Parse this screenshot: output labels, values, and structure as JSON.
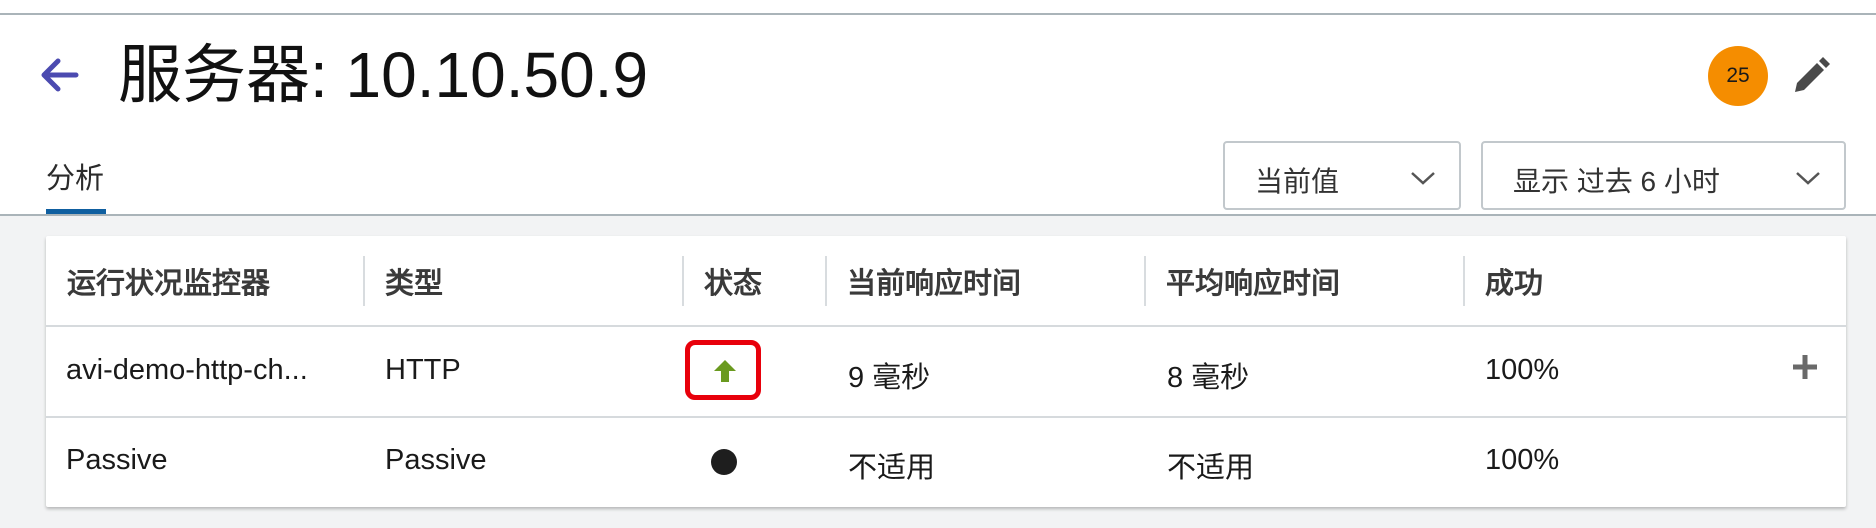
{
  "header": {
    "title": "服务器: 10.10.50.9",
    "alert_count": "25",
    "colors": {
      "badge": "#f58d00",
      "accent": "#4b4ab0",
      "tab_underline": "#0f5fa0",
      "status_up": "#6a9a1f",
      "highlight": "#e8000b"
    }
  },
  "tabs": [
    {
      "label": "分析",
      "active": true
    }
  ],
  "controls": {
    "metric_select": {
      "label": "当前值"
    },
    "time_range_select": {
      "label": "显示 过去 6 小时"
    }
  },
  "table": {
    "columns": [
      "运行状况监控器",
      "类型",
      "状态",
      "当前响应时间",
      "平均响应时间",
      "成功"
    ],
    "rows": [
      {
        "monitor": "avi-demo-http-ch...",
        "type": "HTTP",
        "status": "up-arrow-icon",
        "current_response": "9 毫秒",
        "average_response": "8 毫秒",
        "success": "100%"
      },
      {
        "monitor": "Passive",
        "type": "Passive",
        "status": "black-dot-icon",
        "current_response": "不适用",
        "average_response": "不适用",
        "success": "100%"
      }
    ]
  }
}
